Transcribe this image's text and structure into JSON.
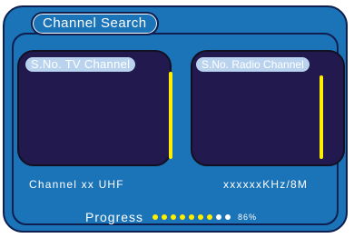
{
  "window": {
    "title": "Channel Search"
  },
  "tv_panel": {
    "header": "S.No. TV Channel"
  },
  "radio_panel": {
    "header": "S.No. Radio Channel"
  },
  "info": {
    "channel": "Channel  xx UHF",
    "frequency": "xxxxxxKHz/8M"
  },
  "progress": {
    "label": "Progress",
    "value_text": "86%",
    "dots_filled": 7,
    "dots_total": 9
  },
  "colors": {
    "background": "#1b73b8",
    "panel": "#221a4f",
    "accent": "#ffee00",
    "header_highlight": "#b9d3ee"
  }
}
